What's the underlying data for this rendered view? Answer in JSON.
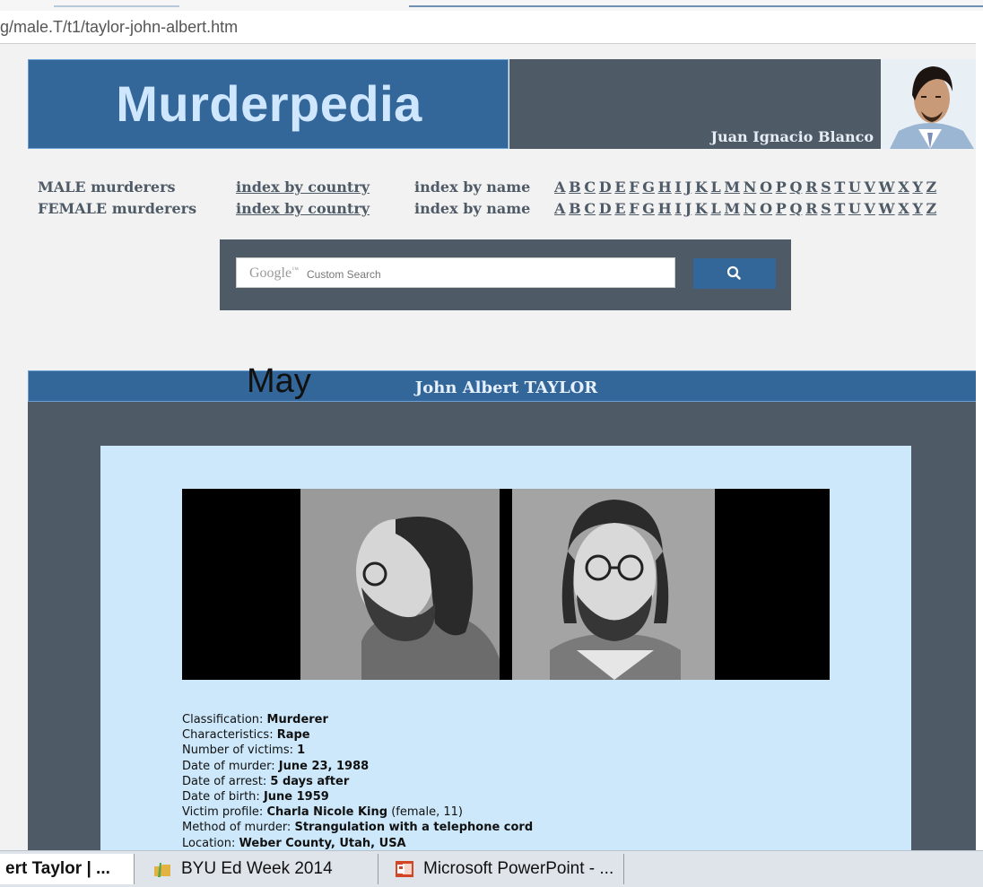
{
  "browser": {
    "url": "g/male.T/t1/taylor-john-albert.htm"
  },
  "header": {
    "site_title": "Murderpedia",
    "author_name": "Juan Ignacio Blanco"
  },
  "nav": {
    "male_label": "MALE murderers",
    "female_label": "FEMALE murderers",
    "index_by_country": "index by country",
    "index_by_name": "index by name",
    "letters": [
      "A",
      "B",
      "C",
      "D",
      "E",
      "F",
      "G",
      "H",
      "I",
      "J",
      "K",
      "L",
      "M",
      "N",
      "O",
      "P",
      "Q",
      "R",
      "S",
      "T",
      "U",
      "V",
      "W",
      "X",
      "Y",
      "Z"
    ]
  },
  "search": {
    "brand": "Google",
    "trademark": "™",
    "placeholder": "Custom Search",
    "icon": "search-icon"
  },
  "overlay_text": "May",
  "profile": {
    "title": "John Albert TAYLOR",
    "facts": [
      {
        "label": "Classification: ",
        "value": "Murderer",
        "extra": ""
      },
      {
        "label": "Characteristics: ",
        "value": "Rape",
        "extra": ""
      },
      {
        "label": "Number of victims: ",
        "value": "1",
        "extra": ""
      },
      {
        "label": "Date of murder: ",
        "value": "June 23, 1988",
        "extra": ""
      },
      {
        "label": "Date of arrest: ",
        "value": "5 days after",
        "extra": ""
      },
      {
        "label": "Date of birth: ",
        "value": "June 1959",
        "extra": ""
      },
      {
        "label": "Victim profile: ",
        "value": "Charla Nicole King",
        "extra": " (female, 11)"
      },
      {
        "label": "Method of murder: ",
        "value": "Strangulation with a telephone cord",
        "extra": ""
      },
      {
        "label": "Location: ",
        "value": "Weber County, Utah, USA",
        "extra": ""
      }
    ]
  },
  "taskbar": {
    "items": [
      {
        "label": "ert Taylor | ...",
        "icon": "browser-icon",
        "active": true
      },
      {
        "label": "BYU Ed Week 2014",
        "icon": "folder-icon",
        "active": false
      },
      {
        "label": "Microsoft PowerPoint - ...",
        "icon": "powerpoint-icon",
        "active": false
      }
    ]
  },
  "colors": {
    "brand_blue": "#336699",
    "slate": "#4e5a66",
    "card_bg": "#cce8fa",
    "logo_text": "#cfe6ff"
  }
}
